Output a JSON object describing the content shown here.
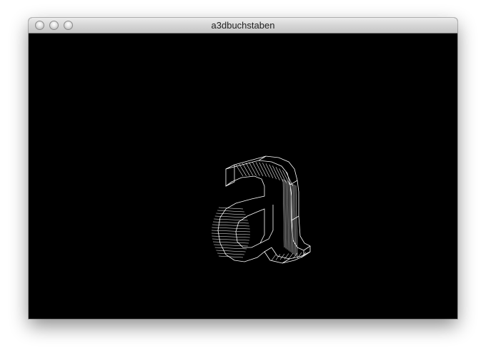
{
  "window": {
    "title": "a3dbuchstaben",
    "buttons": [
      "close",
      "minimize",
      "zoom"
    ]
  },
  "canvas": {
    "background": "#000000",
    "wire_color": "#ffffff",
    "glyph": "a",
    "render_mode": "wireframe-3d"
  }
}
